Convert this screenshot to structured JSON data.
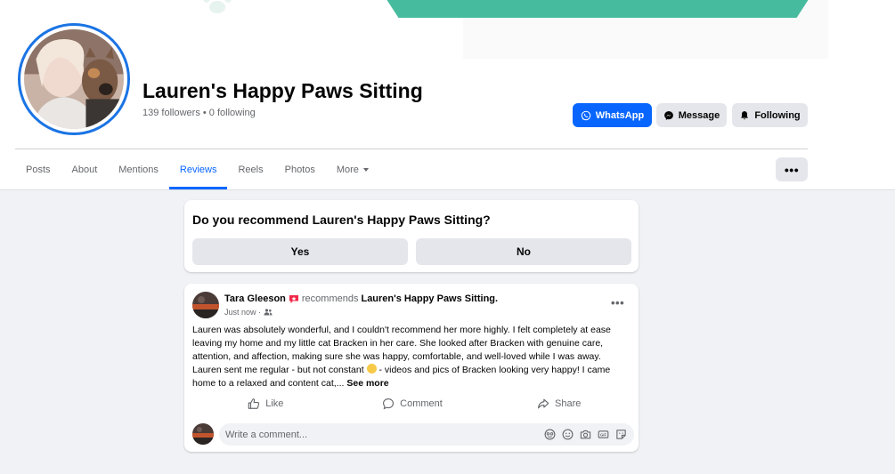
{
  "page": {
    "name": "Lauren's Happy Paws Sitting",
    "followers": "139 followers • 0 following"
  },
  "header_buttons": {
    "whatsapp": "WhatsApp",
    "message": "Message",
    "following": "Following"
  },
  "tabs": [
    {
      "label": "Posts",
      "active": false
    },
    {
      "label": "About",
      "active": false
    },
    {
      "label": "Mentions",
      "active": false
    },
    {
      "label": "Reviews",
      "active": true
    },
    {
      "label": "Reels",
      "active": false
    },
    {
      "label": "Photos",
      "active": false
    },
    {
      "label": "More",
      "active": false
    }
  ],
  "more_button": "•••",
  "recommend": {
    "question": "Do you recommend Lauren's Happy Paws Sitting?",
    "yes": "Yes",
    "no": "No"
  },
  "review": {
    "author": "Tara Gleeson",
    "recommends": "recommends",
    "page": "Lauren's Happy Paws Sitting.",
    "time": "Just now ·",
    "menu": "•••",
    "body_part1": "Lauren was absolutely wonderful, and I couldn't recommend her more highly. I felt completely at ease leaving my home and my little cat Bracken in her care.  She looked after Bracken with genuine care, attention, and affection, making sure she was happy, comfortable, and well-loved while I was away.  Lauren sent me regular - but not constant",
    "body_part2": " - videos and pics of Bracken looking very happy!  I came home to a relaxed and content cat,...",
    "see_more": "See more",
    "actions": {
      "like": "Like",
      "comment": "Comment",
      "share": "Share"
    },
    "comment_placeholder": "Write a comment..."
  },
  "colors": {
    "accent": "#0866ff",
    "cover_band": "#47bb9e",
    "avatar_ring": "#1b74e4",
    "recommend_badge": "#f02849"
  },
  "icons": [
    "whatsapp-icon",
    "messenger-icon",
    "bell-icon",
    "recommend-badge-icon",
    "audience-friends-icon",
    "like-icon",
    "comment-icon",
    "share-icon",
    "avatar-icon",
    "emoji-icon",
    "camera-icon",
    "gif-icon",
    "sticker-icon"
  ]
}
